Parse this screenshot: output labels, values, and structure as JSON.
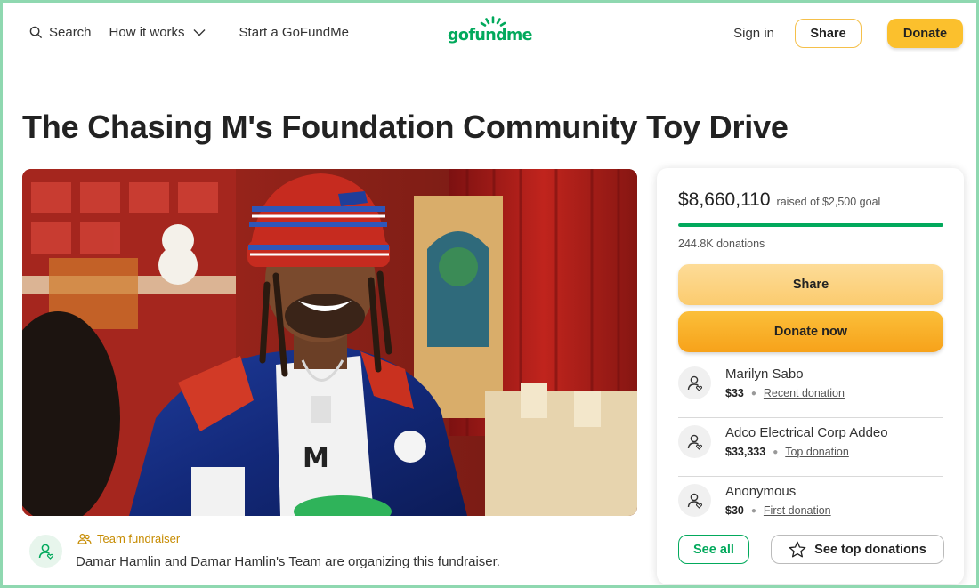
{
  "header": {
    "search_label": "Search",
    "how_label": "How it works",
    "start_label": "Start a GoFundMe",
    "logo_text": "gofundme",
    "signin_label": "Sign in",
    "share_label": "Share",
    "donate_label": "Donate"
  },
  "campaign": {
    "title": "The Chasing M's Foundation Community Toy Drive",
    "organizer_badge": "Team fundraiser",
    "organizer_text": "Damar Hamlin and Damar Hamlin's Team are organizing this fundraiser."
  },
  "card": {
    "raised_amount": "$8,660,110",
    "raised_goal": "raised of $2,500 goal",
    "progress_fraction": 1.0,
    "donations_count": "244.8K donations",
    "share_label": "Share",
    "donate_label": "Donate now",
    "donors": [
      {
        "name": "Marilyn Sabo",
        "amount": "$33",
        "tag": "Recent donation"
      },
      {
        "name": "Adco Electrical Corp Addeo",
        "amount": "$33,333",
        "tag": "Top donation"
      },
      {
        "name": "Anonymous",
        "amount": "$30",
        "tag": "First donation"
      }
    ],
    "see_all_label": "See all",
    "see_top_label": "See top donations"
  },
  "colors": {
    "brand_green": "#02a95c",
    "donate_yellow": "#fbc02d",
    "frame": "#8fd8b0"
  },
  "icons": {
    "search": "search-icon",
    "chevron": "chevron-down-icon",
    "team": "team-icon",
    "user": "user-heart-icon",
    "star": "star-icon"
  }
}
